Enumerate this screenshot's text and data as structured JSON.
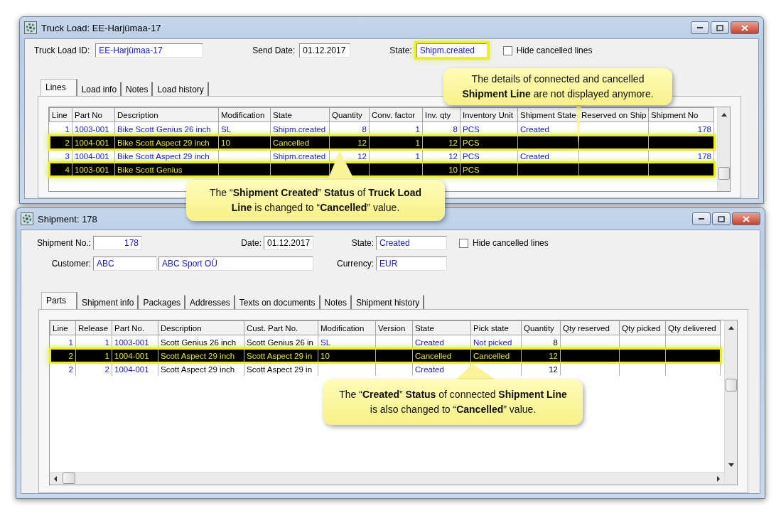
{
  "truck_load_window": {
    "title": "Truck Load: EE-Harjümaa-17",
    "truck_load_id": {
      "label": "Truck Load ID:",
      "value": "EE-Harjümaa-17"
    },
    "send_date": {
      "label": "Send Date:",
      "value": "01.12.2017"
    },
    "state": {
      "label": "State:",
      "value": "Shipm.created",
      "highlighted": true
    },
    "hide_cancelled": {
      "label": "Hide cancelled lines",
      "checked": false
    },
    "tabs": [
      {
        "label": "Lines",
        "selected": true
      },
      {
        "label": "Load info",
        "selected": false
      },
      {
        "label": "Notes",
        "selected": false
      },
      {
        "label": "Load history",
        "selected": false
      }
    ],
    "table": {
      "columns": [
        "Line",
        "Part No",
        "Description",
        "Modification",
        "State",
        "Quantity",
        "Conv. factor",
        "Inv. qty",
        "Inventory Unit",
        "Shipment State",
        "Reserved on Ship",
        "Shipment No"
      ],
      "rows": [
        {
          "highlighted": false,
          "cells": [
            "1",
            "1003-001",
            "Bike Scott Genius 26 inch",
            "SL",
            "Shipm.created",
            "8",
            "1",
            "8",
            "PCS",
            "Created",
            null,
            "178"
          ]
        },
        {
          "highlighted": true,
          "cells": [
            "2",
            "1004-001",
            "Bike Scott Aspect 29 inch",
            "10",
            "Cancelled",
            "12",
            "1",
            "12",
            "PCS",
            null,
            null,
            null
          ]
        },
        {
          "highlighted": false,
          "cells": [
            "3",
            "1004-001",
            "Bike Scott Aspect 29 inch",
            null,
            "Shipm.created",
            "12",
            "1",
            "12",
            "PCS",
            "Created",
            null,
            "178"
          ]
        },
        {
          "highlighted": true,
          "cells": [
            "4",
            "1003-001",
            "Bike Scott Genius",
            null,
            null,
            null,
            null,
            "10",
            "PCS",
            null,
            null,
            null
          ]
        }
      ]
    }
  },
  "shipment_window": {
    "title": "Shipment: 178",
    "shipment_no": {
      "label": "Shipment No.:",
      "value": "178"
    },
    "date": {
      "label": "Date:",
      "value": "01.12.2017"
    },
    "state": {
      "label": "State:",
      "value": "Created",
      "highlighted": false
    },
    "hide_cancelled": {
      "label": "Hide cancelled lines",
      "checked": false
    },
    "customer": {
      "label": "Customer:",
      "code": "ABC",
      "name": "ABC Sport OÜ"
    },
    "currency": {
      "label": "Currency:",
      "value": "EUR"
    },
    "tabs": [
      {
        "label": "Parts",
        "selected": true
      },
      {
        "label": "Shipment info",
        "selected": false
      },
      {
        "label": "Packages",
        "selected": false
      },
      {
        "label": "Addresses",
        "selected": false
      },
      {
        "label": "Texts on documents",
        "selected": false
      },
      {
        "label": "Notes",
        "selected": false
      },
      {
        "label": "Shipment history",
        "selected": false
      }
    ],
    "table": {
      "columns": [
        "Line",
        "Release",
        "Part No.",
        "Description",
        "Cust. Part No.",
        "Modification",
        "Version",
        "State",
        "Pick state",
        "Quantity",
        "Qty reserved",
        "Qty picked",
        "Qty delivered"
      ],
      "rows": [
        {
          "highlighted": false,
          "cells": [
            "1",
            "1",
            "1003-001",
            "Scott Genius 26 inch",
            "Scott Genius 26 in",
            "SL",
            null,
            "Created",
            "Not picked",
            "8",
            null,
            null,
            null
          ]
        },
        {
          "highlighted": true,
          "cells": [
            "2",
            "1",
            "1004-001",
            "Scott Aspect 29 inch",
            "Scott Aspect 29 in",
            "10",
            null,
            "Cancelled",
            "Cancelled",
            "12",
            null,
            null,
            null
          ]
        },
        {
          "highlighted": false,
          "cells": [
            "2",
            "2",
            "1004-001",
            "Scott Aspect 29 inch",
            "Scott Aspect 29 in",
            null,
            null,
            "Created",
            null,
            "12",
            null,
            null,
            null
          ]
        }
      ]
    }
  },
  "callouts": [
    {
      "text": "The details of connected and cancelled **Shipment Line** are not displayed anymore."
    },
    {
      "text": "The “**Shipment Created**” **Status** of **Truck Load Line** is changed to “**Cancelled**” value."
    },
    {
      "text": "The “**Created**” **Status** of connected **Shipment Line** is also changed to “**Cancelled**” value."
    }
  ]
}
